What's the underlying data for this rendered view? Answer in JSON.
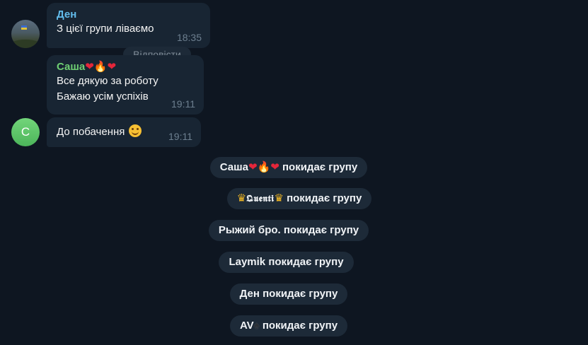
{
  "messages": [
    {
      "sender": "Ден",
      "text": "З цієї групи ліваємо",
      "time": "18:35"
    },
    {
      "sender": "Саша",
      "sender_emoji": [
        "heart",
        "fire",
        "heart"
      ],
      "lines": [
        "Все дякую за роботу",
        "Бажаю усім успіхів"
      ],
      "time": "19:11"
    },
    {
      "text": "До побачення",
      "emoji": "smiling-face",
      "time": "19:11",
      "avatar_letter": "С"
    }
  ],
  "reply_hint": "Відповісти",
  "service_messages": [
    {
      "name": "Саша",
      "decoration": [
        "heart",
        "fire",
        "heart"
      ],
      "action": "покидає групу"
    },
    {
      "name": "𝕼𝖚𝖊𝖓𝖙𝖎",
      "decoration": [
        "crown",
        "crown"
      ],
      "action": "покидає групу"
    },
    {
      "name": "Рыжий бро.",
      "action": "покидає групу"
    },
    {
      "name": "Laymik",
      "action": "покидає групу"
    },
    {
      "name": "Ден",
      "action": "покидає групу"
    },
    {
      "name": "AV",
      "decoration": [
        "spade"
      ],
      "action": "покидає групу"
    }
  ],
  "colors": {
    "background": "#0e1621",
    "bubble": "#182533",
    "sender_den": "#62bcec",
    "sender_sasha": "#6fcf73",
    "timestamp": "#6d7f8f"
  }
}
